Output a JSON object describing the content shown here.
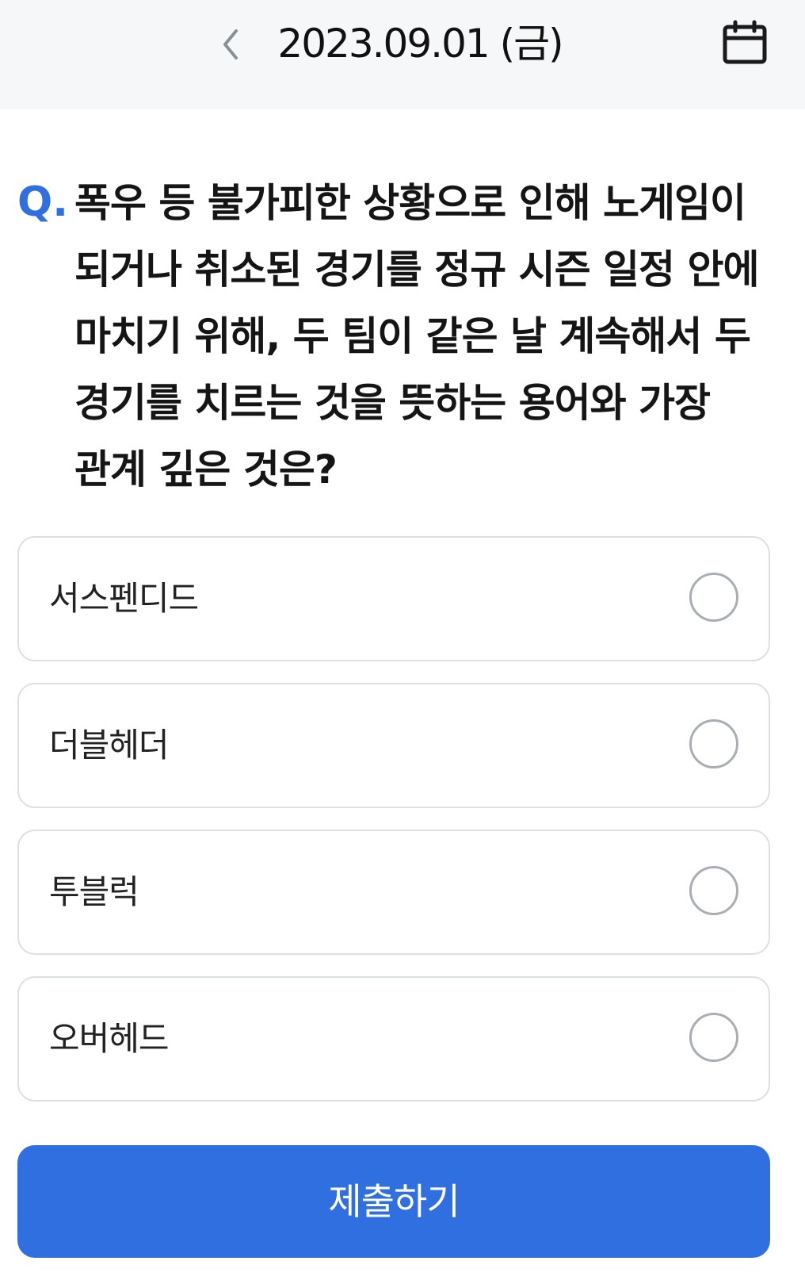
{
  "header": {
    "back_icon": "chevron-left-icon",
    "date": "2023.09.01 (금)",
    "calendar_icon": "calendar-icon"
  },
  "quiz": {
    "question_marker": "Q.",
    "question": "폭우 등 불가피한 상황으로 인해 노게임이 되거나 취소된 경기를 정규 시즌 일정 안에 마치기 위해, 두 팀이 같은 날 계속해서 두 경기를 치르는 것을 뜻하는 용어와 가장 관계 깊은 것은?",
    "options": [
      {
        "label": "서스펜디드"
      },
      {
        "label": "더블헤더"
      },
      {
        "label": "투블럭"
      },
      {
        "label": "오버헤드"
      }
    ],
    "submit_label": "제출하기"
  },
  "colors": {
    "accent": "#2f6fdf",
    "header_bg": "#f6f7f9",
    "option_border": "#dcdfe4",
    "radio_border": "#a9adb4"
  }
}
